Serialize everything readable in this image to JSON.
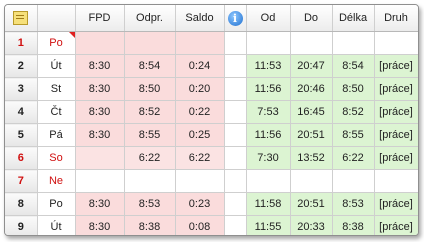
{
  "columns": {
    "fpd": "FPD",
    "odpr": "Odpr.",
    "saldo": "Saldo",
    "info": "i",
    "od": "Od",
    "do": "Do",
    "delka": "Délka",
    "druh": "Druh"
  },
  "rows": [
    {
      "num": "1",
      "day": "Po",
      "fpd": "",
      "odpr": "",
      "saldo": "",
      "od": "",
      "do": "",
      "delka": "",
      "druh": ""
    },
    {
      "num": "2",
      "day": "Út",
      "fpd": "8:30",
      "odpr": "8:54",
      "saldo": "0:24",
      "od": "11:53",
      "do": "20:47",
      "delka": "8:54",
      "druh": "[práce]"
    },
    {
      "num": "3",
      "day": "St",
      "fpd": "8:30",
      "odpr": "8:50",
      "saldo": "0:20",
      "od": "11:56",
      "do": "20:46",
      "delka": "8:50",
      "druh": "[práce]"
    },
    {
      "num": "4",
      "day": "Čt",
      "fpd": "8:30",
      "odpr": "8:52",
      "saldo": "0:22",
      "od": "7:53",
      "do": "16:45",
      "delka": "8:52",
      "druh": "[práce]"
    },
    {
      "num": "5",
      "day": "Pá",
      "fpd": "8:30",
      "odpr": "8:55",
      "saldo": "0:25",
      "od": "11:56",
      "do": "20:51",
      "delka": "8:55",
      "druh": "[práce]"
    },
    {
      "num": "6",
      "day": "So",
      "fpd": "",
      "odpr": "6:22",
      "saldo": "6:22",
      "od": "7:30",
      "do": "13:52",
      "delka": "6:22",
      "druh": "[práce]"
    },
    {
      "num": "7",
      "day": "Ne",
      "fpd": "",
      "odpr": "",
      "saldo": "",
      "od": "",
      "do": "",
      "delka": "",
      "druh": ""
    },
    {
      "num": "8",
      "day": "Po",
      "fpd": "8:30",
      "odpr": "8:53",
      "saldo": "0:23",
      "od": "11:58",
      "do": "20:51",
      "delka": "8:53",
      "druh": "[práce]"
    },
    {
      "num": "9",
      "day": "Út",
      "fpd": "8:30",
      "odpr": "8:38",
      "saldo": "0:08",
      "od": "11:55",
      "do": "20:33",
      "delka": "8:38",
      "druh": "[práce]"
    }
  ],
  "colors": {
    "fund_bg": "#fadcdc",
    "work_bg": "#dcf4d2",
    "weekend_text": "#d01010",
    "marker": "#e02020"
  },
  "icons": {
    "header_left": "note-icon",
    "header_info": "info-icon"
  }
}
